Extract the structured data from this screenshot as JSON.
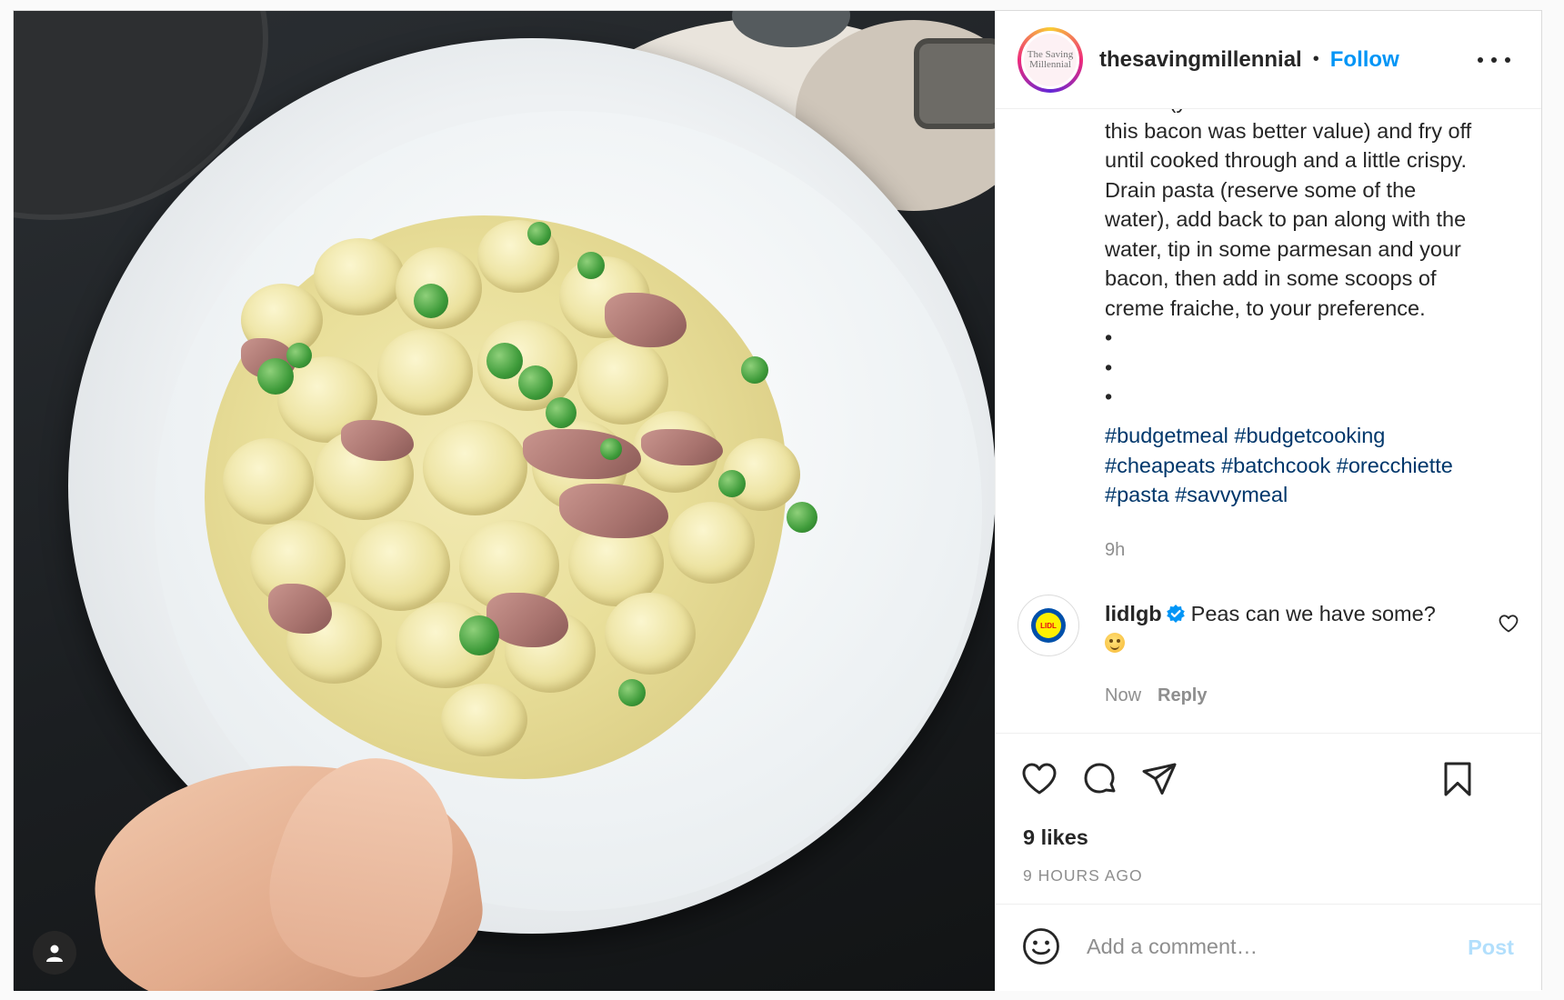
{
  "post": {
    "username": "thesavingmillennial",
    "separator": "•",
    "follow_label": "Follow",
    "avatar_logo_top": "The Saving",
    "avatar_logo_bottom": "Millennial"
  },
  "caption": {
    "lines": [
      "bacon (you can use bacon lardons but",
      "this bacon was better value) and fry off",
      "until cooked through and a little crispy.",
      "Drain pasta (reserve some of the",
      "water), add back to pan along with the",
      "water, tip in some parmesan and your",
      "bacon, then add in some scoops of",
      "creme fraiche, to your preference.",
      "•",
      "•",
      "•"
    ],
    "hashtag_lines": [
      [
        "#budgetmeal",
        "#budgetcooking"
      ],
      [
        "#cheapeats",
        "#batchcook",
        "#orecchiette"
      ],
      [
        "#pasta",
        "#savvymeal"
      ]
    ],
    "time": "9h"
  },
  "comment": {
    "username": "lidlgb",
    "text": "Peas can we have some?",
    "emoji": "yum-face-emoji",
    "time": "Now",
    "reply_label": "Reply",
    "avatar_logo": "LIDL"
  },
  "actions": {
    "likes": "9 likes",
    "age": "9 HOURS AGO",
    "icons": [
      "heart-icon",
      "comment-icon",
      "share-icon",
      "bookmark-icon"
    ]
  },
  "composer": {
    "placeholder": "Add a comment…",
    "post_label": "Post"
  },
  "colors": {
    "accent": "#0095f6",
    "hashtag": "#00376b",
    "muted": "#8e8e8e",
    "text": "#262626",
    "post_disabled": "#b2dffc"
  }
}
